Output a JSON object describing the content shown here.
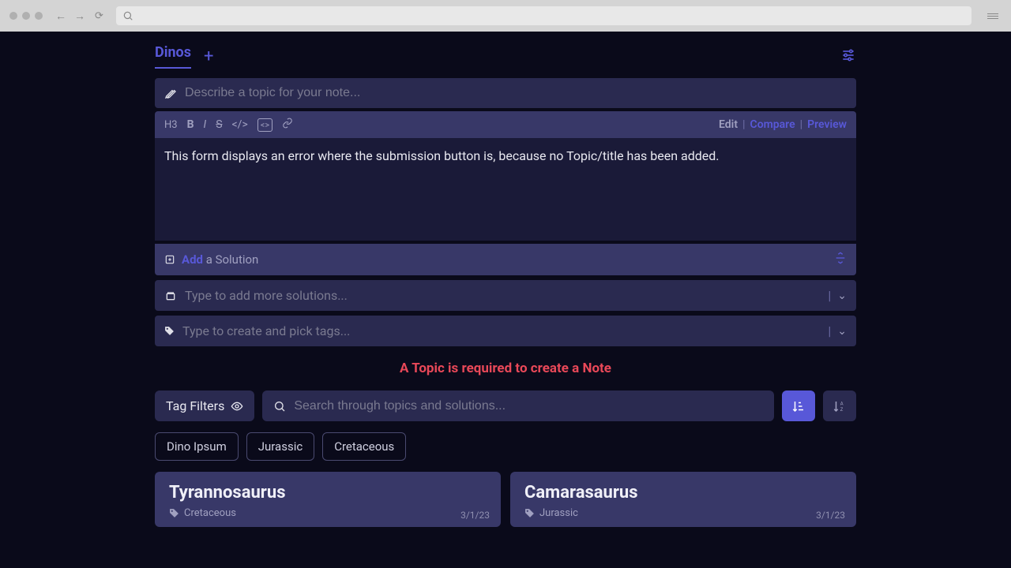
{
  "tab": {
    "active": "Dinos"
  },
  "topic": {
    "placeholder": "Describe a topic for your note..."
  },
  "toolbar": {
    "h3": "H3",
    "bold": "B",
    "italic": "I",
    "strike": "S",
    "edit": "Edit",
    "compare": "Compare",
    "preview": "Preview"
  },
  "editor": {
    "content": "This form displays an error where the submission button is, because no Topic/title has been added."
  },
  "add_solution": {
    "add": "Add",
    "rest": " a Solution"
  },
  "more_solutions": {
    "placeholder": "Type to add more solutions..."
  },
  "tags": {
    "placeholder": "Type to create and pick tags..."
  },
  "error": {
    "message": "A Topic is required to create a Note"
  },
  "tag_filters": {
    "label": "Tag Filters"
  },
  "search": {
    "placeholder": "Search through topics and solutions..."
  },
  "chips": [
    "Dino Ipsum",
    "Jurassic",
    "Cretaceous"
  ],
  "cards": [
    {
      "title": "Tyrannosaurus",
      "tag": "Cretaceous",
      "date": "3/1/23"
    },
    {
      "title": "Camarasaurus",
      "tag": "Jurassic",
      "date": "3/1/23"
    }
  ]
}
